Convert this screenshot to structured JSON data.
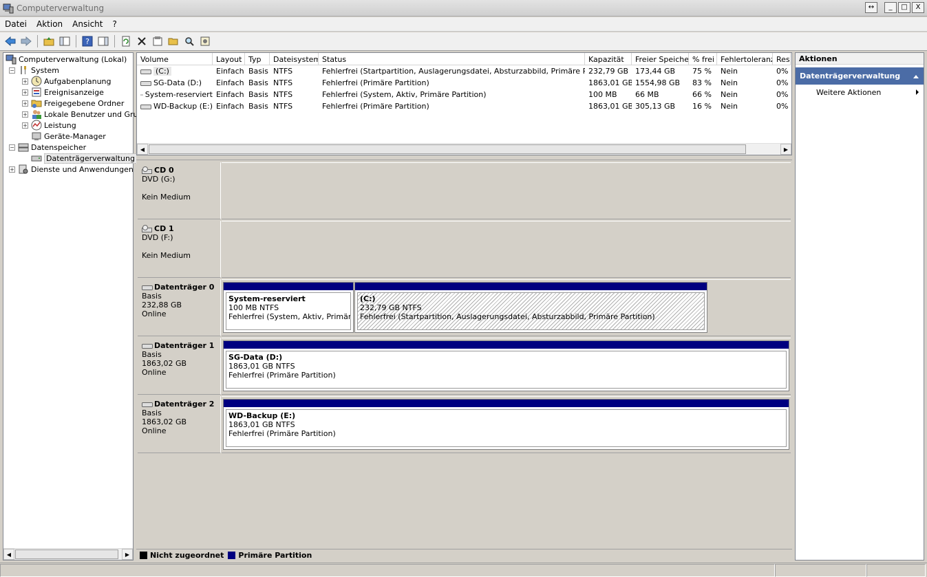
{
  "window": {
    "title": "Computerverwaltung",
    "buttons": [
      "↔",
      "_",
      "□",
      "X"
    ]
  },
  "menu": [
    "Datei",
    "Aktion",
    "Ansicht",
    "?"
  ],
  "tree": {
    "root": "Computerverwaltung (Lokal)",
    "system": "System",
    "items": [
      "Aufgabenplanung",
      "Ereignisanzeige",
      "Freigegebene Ordner",
      "Lokale Benutzer und Grupp",
      "Leistung",
      "Geräte-Manager"
    ],
    "storage": "Datenspeicher",
    "disk_mgmt": "Datenträgerverwaltung",
    "services": "Dienste und Anwendungen"
  },
  "volumes": {
    "headers": [
      "Volume",
      "Layout",
      "Typ",
      "Dateisystem",
      "Status",
      "Kapazität",
      "Freier Speicher",
      "% frei",
      "Fehlertoleranz",
      "Res"
    ],
    "rows": [
      [
        "(C:)",
        "Einfach",
        "Basis",
        "NTFS",
        "Fehlerfrei (Startpartition, Auslagerungsdatei, Absturzabbild, Primäre Partition)",
        "232,79 GB",
        "173,44 GB",
        "75 %",
        "Nein",
        "0%"
      ],
      [
        "SG-Data (D:)",
        "Einfach",
        "Basis",
        "NTFS",
        "Fehlerfrei (Primäre Partition)",
        "1863,01 GB",
        "1554,98 GB",
        "83 %",
        "Nein",
        "0%"
      ],
      [
        "System-reserviert",
        "Einfach",
        "Basis",
        "NTFS",
        "Fehlerfrei (System, Aktiv, Primäre Partition)",
        "100 MB",
        "66 MB",
        "66 %",
        "Nein",
        "0%"
      ],
      [
        "WD-Backup (E:)",
        "Einfach",
        "Basis",
        "NTFS",
        "Fehlerfrei (Primäre Partition)",
        "1863,01 GB",
        "305,13 GB",
        "16 %",
        "Nein",
        "0%"
      ]
    ]
  },
  "disks": [
    {
      "name": "CD 0",
      "l1": "DVD (G:)",
      "l2": "",
      "l3": "Kein Medium"
    },
    {
      "name": "CD 1",
      "l1": "DVD (F:)",
      "l2": "",
      "l3": "Kein Medium"
    },
    {
      "name": "Datenträger 0",
      "l1": "Basis",
      "l2": "232,88 GB",
      "l3": "Online",
      "parts": [
        {
          "title": "System-reserviert",
          "size": "100 MB NTFS",
          "status": "Fehlerfrei (System, Aktiv, Primäre Partition)"
        },
        {
          "title": "(C:)",
          "size": "232,79 GB NTFS",
          "status": "Fehlerfrei (Startpartition, Auslagerungsdatei, Absturzabbild, Primäre Partition)"
        }
      ]
    },
    {
      "name": "Datenträger 1",
      "l1": "Basis",
      "l2": "1863,02 GB",
      "l3": "Online",
      "parts": [
        {
          "title": "SG-Data  (D:)",
          "size": "1863,01 GB NTFS",
          "status": "Fehlerfrei (Primäre Partition)"
        }
      ]
    },
    {
      "name": "Datenträger 2",
      "l1": "Basis",
      "l2": "1863,02 GB",
      "l3": "Online",
      "parts": [
        {
          "title": "WD-Backup  (E:)",
          "size": "1863,01 GB NTFS",
          "status": "Fehlerfrei (Primäre Partition)"
        }
      ]
    }
  ],
  "legend": {
    "unallocated": "Nicht zugeordnet",
    "primary": "Primäre Partition",
    "unallocated_color": "#000000",
    "primary_color": "#000080"
  },
  "actions": {
    "header": "Aktionen",
    "section": "Datenträgerverwaltung",
    "more": "Weitere Aktionen"
  }
}
